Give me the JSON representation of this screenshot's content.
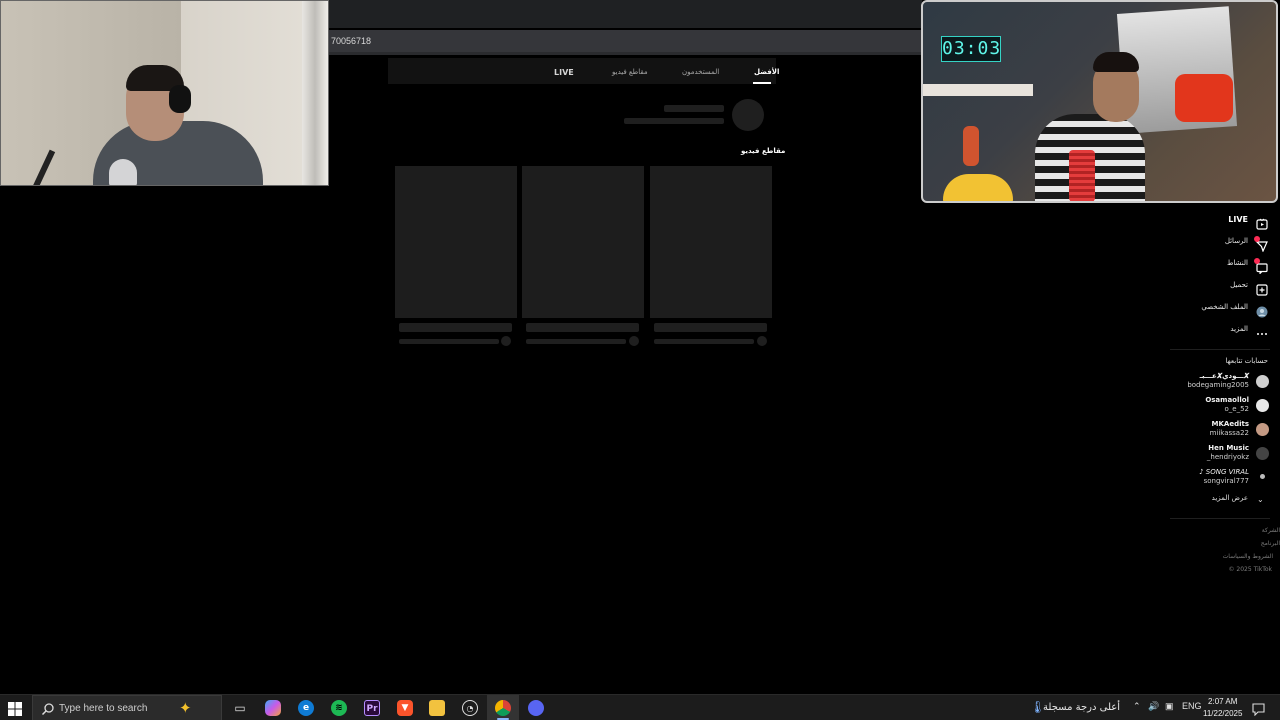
{
  "browser": {
    "address_fragment": "70056718"
  },
  "tiktok": {
    "tabs": [
      {
        "label": "LIVE"
      },
      {
        "label": "مقاطع فيديو"
      },
      {
        "label": "المستخدمون"
      },
      {
        "label": "الأفضل"
      }
    ],
    "active_tab": "الأفضل",
    "section_title": "مقاطع فيديو",
    "nav": {
      "live": "LIVE",
      "messages": "الرسائل",
      "activity": "النشاط",
      "upload": "تحميل",
      "profile": "الملف الشخصي",
      "more": "المزيد"
    },
    "following_heading": "حسابات تتابعها",
    "accounts": [
      {
        "name": "عـــبـ𝑿ـــودي𝑿",
        "username": "bodegaming2005"
      },
      {
        "name": "Osamaollol",
        "username": "o_e_52"
      },
      {
        "name": "MKAedits",
        "username": "miikassa22"
      },
      {
        "name": "Hen Music",
        "username": "_hendriyokz"
      },
      {
        "name": "♪ SONG VIRAL",
        "username": "songviral777"
      }
    ],
    "show_more": "عرض المزيد",
    "footer": [
      "الشركة",
      "البرنامج",
      "الشروط والسياسات",
      "© 2025 TikTok"
    ]
  },
  "webcam": {
    "clock_display": "03:03"
  },
  "taskbar": {
    "search_placeholder": "Type here to search",
    "weather_text": "أعلى درجة مسجلة",
    "language": "ENG",
    "time": "2:07 AM",
    "date": "11/22/2025"
  },
  "colors": {
    "accent_badge": "#fe2c55",
    "background": "#000000"
  }
}
